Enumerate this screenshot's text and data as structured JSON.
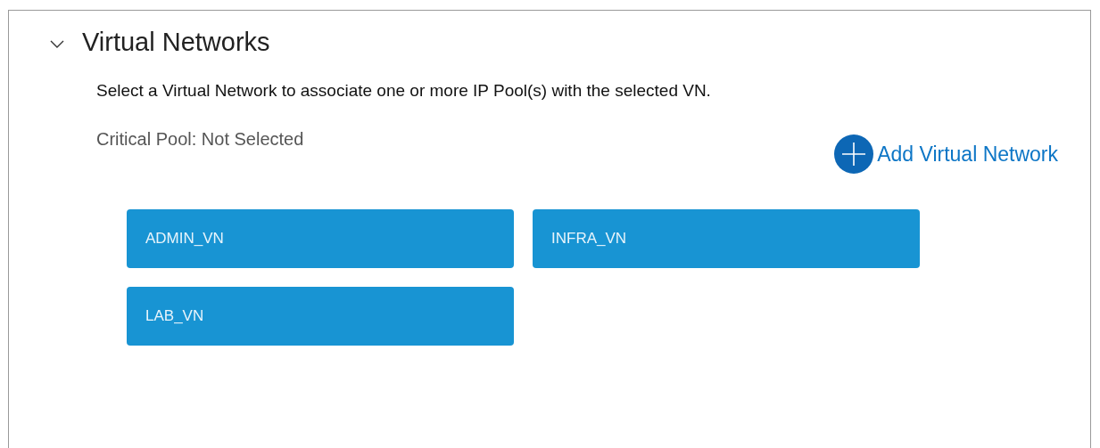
{
  "section": {
    "title": "Virtual Networks",
    "expanded": true
  },
  "instruction": "Select a Virtual Network to associate one or more IP Pool(s) with the selected VN.",
  "critical_pool": "Critical Pool: Not Selected",
  "add_button": "Add Virtual Network",
  "networks": [
    {
      "label": "ADMIN_VN",
      "selected": false
    },
    {
      "label": "INFRA_VN",
      "selected": false
    },
    {
      "label": "LAB_VN",
      "selected": false
    }
  ]
}
